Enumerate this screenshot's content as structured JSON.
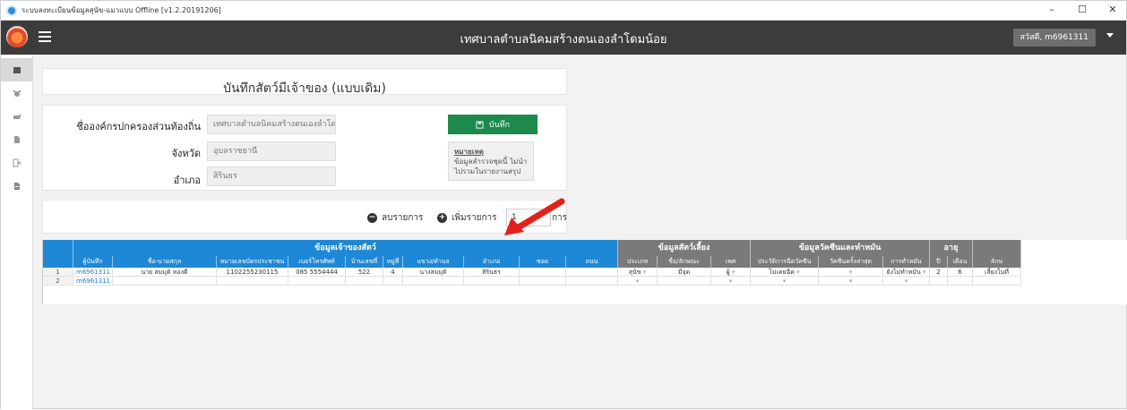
{
  "window": {
    "title": "ระบบลงทะเบียนข้อมูลสุนัข-แมวแบบ Offline [v1.2.20191206]",
    "controls": {
      "minimize": "–",
      "maximize": "☐",
      "close": "✕"
    }
  },
  "header": {
    "title": "เทศบาลตำบลนิคมสร้างตนเองลำโดมน้อย",
    "user": "สวัสดี, m6961311"
  },
  "sidebar": {
    "items": [
      {
        "icon": "home-icon"
      },
      {
        "icon": "paw-icon"
      },
      {
        "icon": "dog-icon"
      },
      {
        "icon": "document-icon"
      },
      {
        "icon": "sign-out-icon"
      },
      {
        "icon": "file-icon"
      }
    ]
  },
  "page": {
    "title": "บันทึกสัตว์มีเจ้าของ (แบบเดิม)"
  },
  "form": {
    "org_label": "ชื่อองค์กรปกครองส่วนท้องถิ่น",
    "org_value": "เทศบาลตำบลนิคมสร้างตนเองลำโดมน้อ",
    "province_label": "จังหวัด",
    "province_value": "อุบลราชธานี",
    "district_label": "อำเภอ",
    "district_value": "สิรินธร",
    "save_label": "บันทึก",
    "note_title": "หมายเหตุ",
    "note_text": "ข้อมูลสำรวจชุดนี้ ไม่นำไปรวมในรายงานสรุป"
  },
  "actions": {
    "delete_label": "ลบรายการ",
    "add_label": "เพิ่มรายการ",
    "qty_value": "1",
    "qty_suffix": "การ"
  },
  "colors": {
    "blue_group": "#1e88d6",
    "gray_group": "#7a7a7a",
    "save_green": "#1d8a4b",
    "header_dark": "#3c3c3c",
    "arrow_red": "#e3211c"
  },
  "grid": {
    "groups": [
      {
        "label": ""
      },
      {
        "label": "ข้อมูลเจ้าของสัตว์"
      },
      {
        "label": "ข้อมูลสัตว์เลี้ยง"
      },
      {
        "label": "ข้อมูลวัคซีนและทำหมัน"
      },
      {
        "label": "อายุ"
      },
      {
        "label": ""
      }
    ],
    "columns": [
      "",
      "ผู้บันทึก",
      "ชื่อ-นามสกุล",
      "หมายเลขบัตรประชาชน",
      "เบอร์โทรศัพท์",
      "บ้านเลขที่",
      "หมู่ที่",
      "แขวง/ตำบล",
      "อำเภอ",
      "ซอย",
      "ถนน",
      "ประเภท",
      "ชื่อ/ลักษณะ",
      "เพศ",
      "ประวัติการฉีดวัคซีน",
      "วัคซีนครั้งล่าสุด",
      "การทำหมัน",
      "ปี",
      "เดือน",
      "ลักษ"
    ],
    "rows": [
      [
        "1",
        "m6961311",
        "นาย สมมุติ ทองดี",
        "1102255230115",
        "085 5554444",
        "522",
        "4",
        "นางสมมุติ",
        "สิรินธร",
        "",
        "",
        "สุนัข",
        "มีจุด",
        "ผู้",
        "ไม่เคยฉีด",
        "",
        "ยังไม่ทำหมัน",
        "2",
        "6",
        "เลี้ยงในที่"
      ],
      [
        "2",
        "m6961311",
        "",
        "",
        "",
        "",
        "",
        "",
        "",
        "",
        "",
        "",
        "",
        "",
        "",
        "",
        "",
        "",
        "",
        ""
      ]
    ]
  }
}
